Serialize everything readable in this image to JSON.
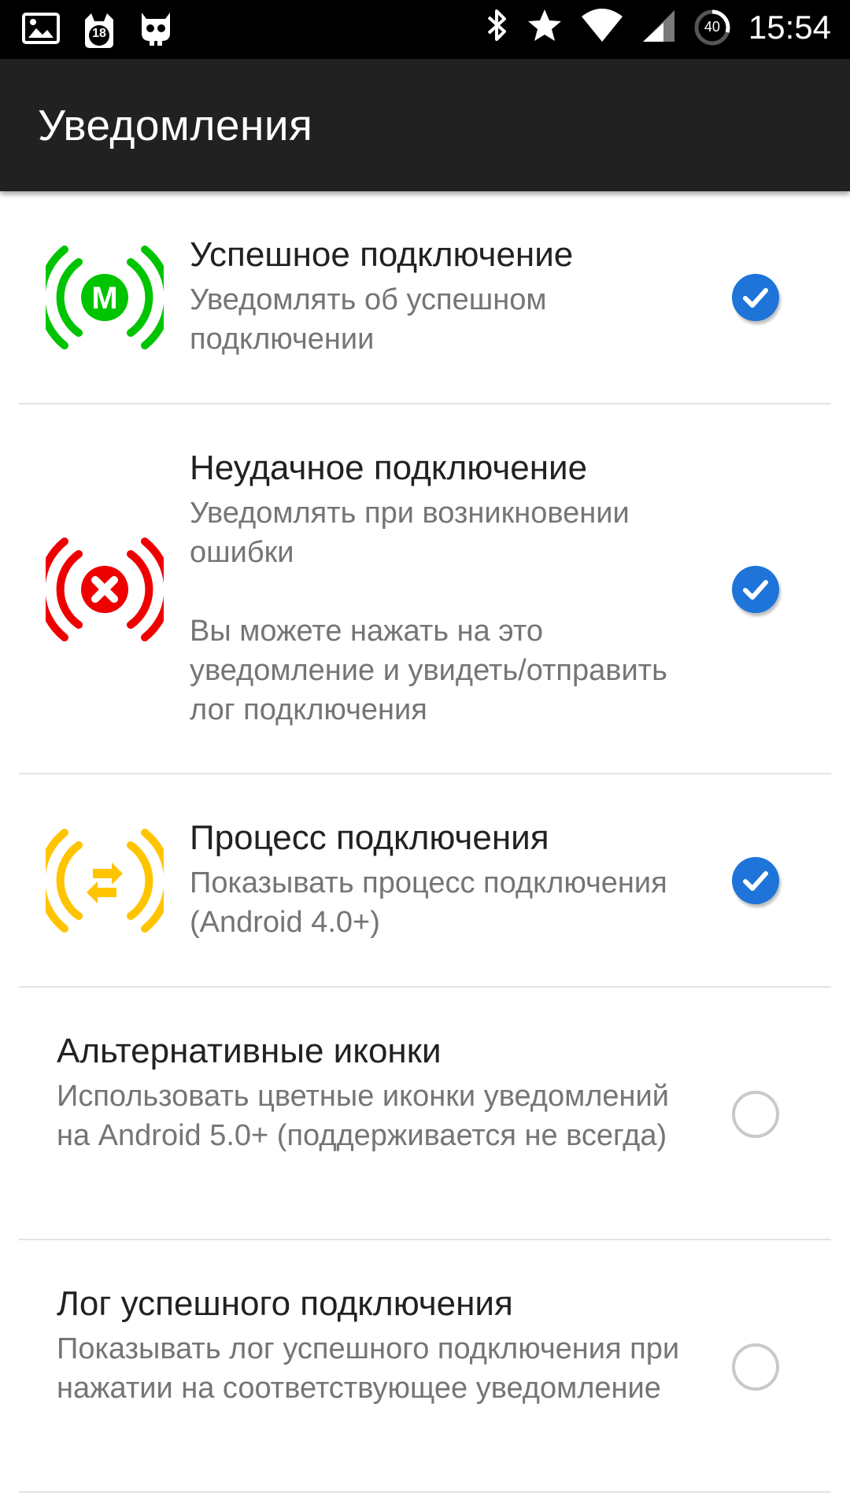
{
  "status_bar": {
    "time": "15:54",
    "notification_badge": "18",
    "battery_level": "40",
    "icons": [
      "image-icon",
      "cat-notification-icon",
      "cyanogen-icon",
      "bluetooth-icon",
      "star-icon",
      "wifi-icon",
      "signal-icon",
      "battery-icon"
    ]
  },
  "app_bar": {
    "title": "Уведомления"
  },
  "settings": [
    {
      "title": "Успешное подключение",
      "summary": "Уведомлять об успешном подключении",
      "summary_extra": "",
      "checked": true,
      "icon": "metro-success-icon",
      "icon_color": "#00c400"
    },
    {
      "title": "Неудачное подключение",
      "summary": "Уведомлять при возникновении ошибки",
      "summary_extra": "Вы можете нажать на это уведомление и увидеть/отправить лог подключения",
      "checked": true,
      "icon": "connection-error-icon",
      "icon_color": "#ee0000"
    },
    {
      "title": "Процесс подключения",
      "summary": "Показывать процесс подключения (Android 4.0+)",
      "summary_extra": "",
      "checked": true,
      "icon": "connecting-process-icon",
      "icon_color": "#ffc400"
    },
    {
      "title": "Альтернативные иконки",
      "summary": "Использовать цветные иконки уведомлений на Android 5.0+ (поддерживается не всегда)",
      "summary_extra": "",
      "checked": false,
      "icon": "",
      "icon_color": ""
    },
    {
      "title": "Лог успешного подключения",
      "summary": "Показывать лог успешного подключения при нажатии на соответствующее уведомление",
      "summary_extra": "",
      "checked": false,
      "icon": "",
      "icon_color": ""
    }
  ],
  "colors": {
    "status_bar": "#000000",
    "app_bar": "#212121",
    "accent": "#1e74d9",
    "title_text": "#212121",
    "summary_text": "#757575",
    "divider": "#e3e3e3"
  }
}
